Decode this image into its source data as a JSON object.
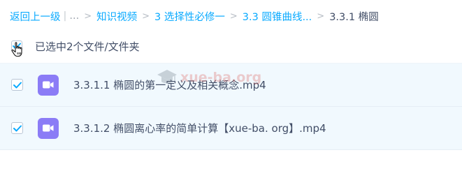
{
  "breadcrumb": {
    "back": "返回上一级",
    "pipe": "|",
    "ellipsis": "...",
    "item1": "知识视频",
    "item2": "3 选择性必修一",
    "item3": "3.3 圆锥曲线...",
    "current": "3.3.1 椭圆",
    "separator": ">"
  },
  "selection": {
    "text": "已选中2个文件/文件夹",
    "all_checked": true
  },
  "files": [
    {
      "name": "3.3.1.1 椭圆的第一定义及相关概念.mp4",
      "checked": true,
      "icon": "video-file-icon"
    },
    {
      "name": "3.3.1.2 椭圆离心率的简单计算【xue-ba. org】.mp4",
      "checked": true,
      "icon": "video-file-icon"
    }
  ],
  "watermark": {
    "text": "xue-ba.org"
  },
  "colors": {
    "link": "#09aaff",
    "check": "#09aaff",
    "row_selected_bg": "#f1f9fe",
    "video_icon": "#8b7cf6",
    "text": "#424e67"
  }
}
